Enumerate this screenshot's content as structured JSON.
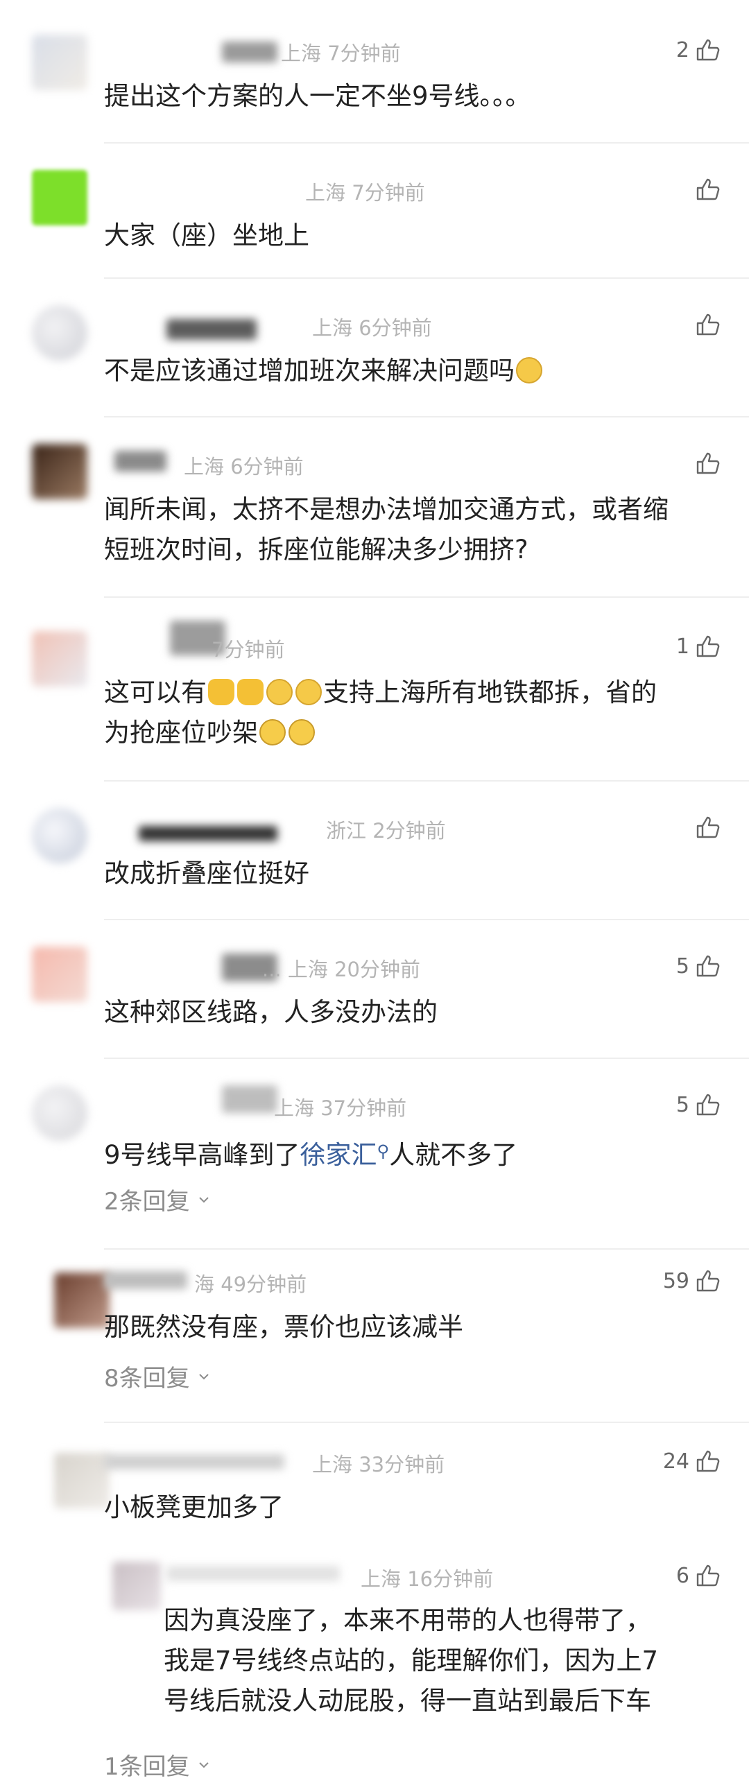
{
  "colors": {
    "text": "#222222",
    "meta": "#b4b4b4",
    "link": "#3a5f9b",
    "replies": "#8c8c8c"
  },
  "comments": [
    {
      "meta": "上海 7分钟前",
      "likes": "2",
      "text": "提出这个方案的人一定不坐9号线。。。"
    },
    {
      "meta": "上海 7分钟前",
      "likes": "",
      "text": "大家（座）坐地上"
    },
    {
      "meta": "上海 6分钟前",
      "likes": "",
      "text": "不是应该通过增加班次来解决问题吗",
      "emoji": "laugh-cry-emoji"
    },
    {
      "meta": "上海 6分钟前",
      "likes": "",
      "text_line1": "闻所未闻，太挤不是想办法增加交通方式，或者缩",
      "text_line2": "短班次时间，拆座位能解决多少拥挤?"
    },
    {
      "meta": "7分钟前",
      "likes": "1",
      "text_a": "这可以有",
      "text_b": "支持上海所有地铁都拆，省的",
      "text_c": "为抢座位吵架"
    },
    {
      "meta": "浙江 2分钟前",
      "likes": "",
      "text": "改成折叠座位挺好"
    },
    {
      "meta": "... 上海 20分钟前",
      "likes": "5",
      "text": "这种郊区线路，人多没办法的"
    },
    {
      "meta": "上海 37分钟前",
      "likes": "5",
      "text_a": "9号线早高峰到了",
      "link": "徐家汇",
      "text_b": "人就不多了",
      "replies": "2条回复"
    },
    {
      "meta": "海 49分钟前",
      "likes": "59",
      "text": "那既然没有座，票价也应该减半",
      "replies": "8条回复"
    },
    {
      "meta": "上海 33分钟前",
      "likes": "24",
      "text": "小板凳更加多了"
    }
  ],
  "reply": {
    "meta": "上海 16分钟前",
    "likes": "6",
    "line1": "因为真没座了，本来不用带的人也得带了，",
    "line2": "我是7号线终点站的，能理解你们，因为上7",
    "line3": "号线后就没人动屁股，得一直站到最后下车",
    "replies": "1条回复"
  }
}
